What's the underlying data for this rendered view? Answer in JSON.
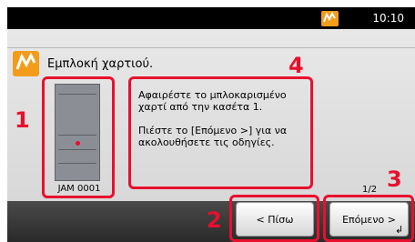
{
  "status_bar": {
    "time": "10:10",
    "warning_icon": "paper-jam-warning-icon"
  },
  "header": {
    "title": "Εμπλοκή χαρτιού.",
    "icon": "paper-jam-warning-icon"
  },
  "jam_illustration": {
    "code": "JAM 0001",
    "icon": "printer-icon"
  },
  "message": {
    "line1": "Αφαιρέστε το μπλοκαρισμένο χαρτί από την κασέτα 1.",
    "line2": "Πιέστε το [Επόμενο >] για να ακολουθήσετε τις οδηγίες."
  },
  "page_indicator": "1/2",
  "buttons": {
    "back": "< Πίσω",
    "next": "Επόμενο >"
  },
  "callouts": [
    "1",
    "2",
    "3",
    "4"
  ],
  "colors": {
    "callout": "#e8102d",
    "warning": "#f39c1a"
  }
}
